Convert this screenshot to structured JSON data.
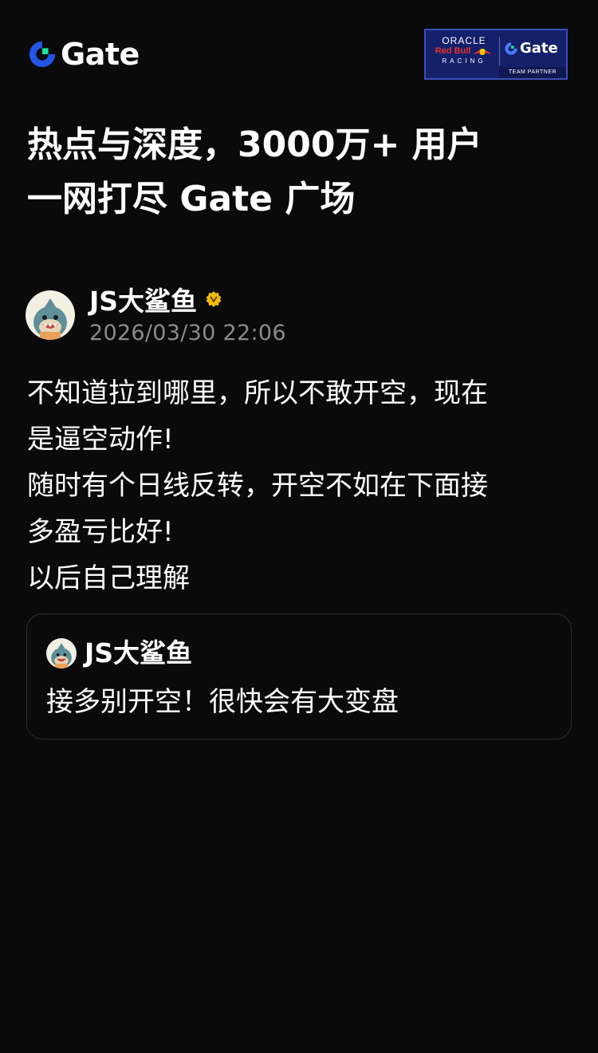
{
  "brand": {
    "logo_text": "Gate",
    "accent_blue": "#2354e6",
    "accent_green": "#17e6a1"
  },
  "partner_badge": {
    "oracle": "ORACLE",
    "redbull": "Red Bull",
    "racing": "RACING",
    "gate": "Gate",
    "team_partner": "TEAM PARTNER"
  },
  "headline": {
    "line1": "热点与深度，3000万+ 用户",
    "line2": "一网打尽 Gate 广场"
  },
  "post": {
    "author_name": "JS大鲨鱼",
    "timestamp": "2026/03/30 22:06",
    "avatar_icon": "shark-avatar-icon",
    "verified_icon": "verified-badge-icon",
    "body_lines": [
      "不知道拉到哪里，所以不敢开空，现在",
      "是逼空动作!",
      "随时有个日线反转，开空不如在下面接",
      "多盈亏比好!",
      "以后自己理解"
    ]
  },
  "quote": {
    "author_name": "JS大鲨鱼",
    "text": "接多别开空！很快会有大变盘"
  }
}
